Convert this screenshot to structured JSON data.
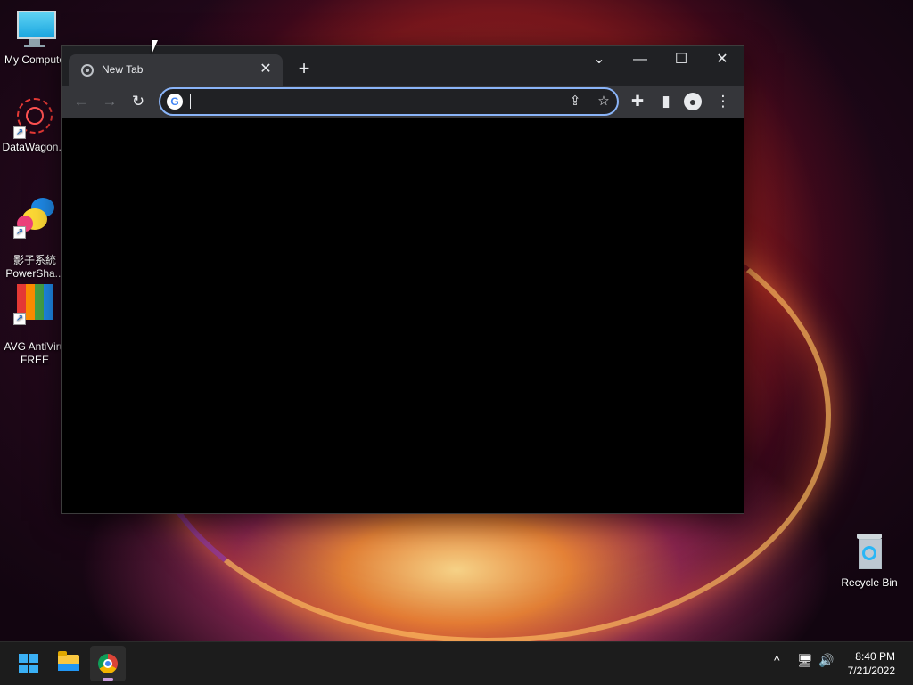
{
  "desktop": {
    "icons": [
      {
        "label": "My Compute",
        "icon": "monitor-icon"
      },
      {
        "label": "DataWagon...",
        "icon": "datawagon-icon"
      },
      {
        "label": "影子系統\nPowerSha...",
        "icon": "powershadow-icon"
      },
      {
        "label": "AVG AntiViru\nFREE",
        "icon": "avg-icon"
      },
      {
        "label": "Recycle Bin",
        "icon": "recycle-bin-icon"
      }
    ]
  },
  "browser": {
    "tab": {
      "title": "New Tab",
      "close": "✕"
    },
    "new_tab": "+",
    "window_controls": {
      "dropdown": "⌄",
      "minimize": "—",
      "maximize": "☐",
      "close": "✕"
    },
    "toolbar": {
      "back": "←",
      "forward": "→",
      "reload": "↻"
    },
    "omnibox": {
      "value": "",
      "placeholder": ""
    },
    "omnibox_icons": {
      "share": "⇪",
      "bookmark": "☆"
    },
    "toolbar_right": {
      "extensions": "✚",
      "side_panel": "▮",
      "profile": "●",
      "menu": "⋮"
    }
  },
  "taskbar": {
    "items": [
      "start",
      "file-explorer",
      "chrome"
    ],
    "tray": {
      "chevron": "^",
      "network": "🖥",
      "volume": "🔊"
    },
    "clock": {
      "time": "8:40 PM",
      "date": "7/21/2022"
    }
  },
  "colors": {
    "accent": "#8ab4f8",
    "tab_active": "#35363a",
    "titlebar": "#202124"
  }
}
